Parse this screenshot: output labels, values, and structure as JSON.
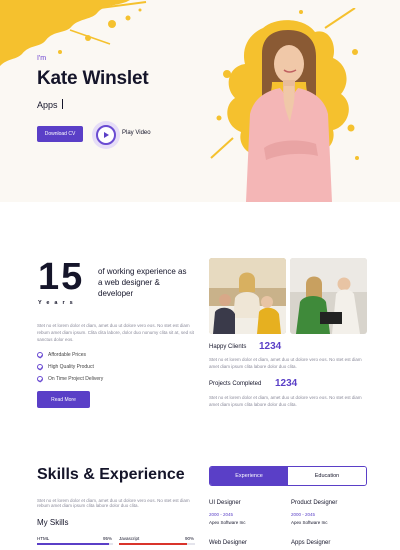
{
  "hero": {
    "greeting": "I'm",
    "name": "Kate Winslet",
    "role": "Apps",
    "download_label": "Download CV",
    "play_label": "Play Video"
  },
  "about": {
    "years_number": "15",
    "years_label": "Years",
    "experience_text": "of working experience as a web designer & developer",
    "paragraph": "Stet no et lorem dolor et diam, amet duo ut dolore vero eos. No stet est diam rebum amet diam ipsum. Clita clita labore, dolor duo nonumy clita sit at, sed sit sanctus dolor eos.",
    "features": [
      "Affordable Prices",
      "High Quality Product",
      "On Time Project Delivery"
    ],
    "read_more_label": "Read More"
  },
  "stats": [
    {
      "label": "Happy Clients",
      "value": "1234",
      "text": "Stet no et lorem dolor et diam, amet duo ut dolore vero eos. No stet est diam amet diam ipsum clita labore dolor duo clita."
    },
    {
      "label": "Projects Completed",
      "value": "1234",
      "text": "Stet no et lorem dolor et diam, amet duo ut dolore vero eos. No stet est diam amet diam ipsum clita labore dolor duo clita."
    }
  ],
  "skills": {
    "title": "Skills & Experience",
    "paragraph": "Stet no et lorem dolor et diam, amet duo ut dolore vero eos. No stet est diam rebum amet diam ipsum clita labore dolor duo clita.",
    "my_skills": "My Skills",
    "items": [
      {
        "name": "HTML",
        "percent": "95%",
        "level": 95,
        "color": "#5a3fc7"
      },
      {
        "name": "Javascript",
        "percent": "90%",
        "level": 90,
        "color": "#d9342b"
      }
    ]
  },
  "tabs": {
    "experience": "Experience",
    "education": "Education"
  },
  "jobs": [
    {
      "title": "UI Designer",
      "years": "2000 - 2045",
      "company": "Apex Software Inc"
    },
    {
      "title": "Product Designer",
      "years": "2000 - 2045",
      "company": "Apex Software Inc"
    },
    {
      "title": "Web Designer",
      "years": "",
      "company": ""
    },
    {
      "title": "Apps Designer",
      "years": "",
      "company": ""
    }
  ],
  "colors": {
    "accent": "#5a3fc7",
    "splash": "#f5c12e",
    "skill_red": "#d9342b"
  }
}
